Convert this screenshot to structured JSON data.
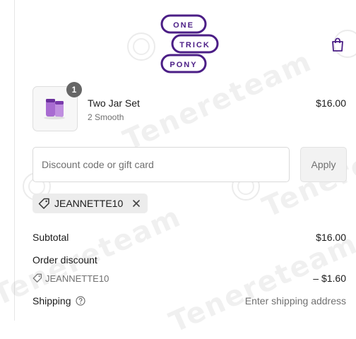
{
  "brand": {
    "logo_lines": [
      "ONE",
      "TRICK",
      "PONY"
    ],
    "color": "#4b1e86"
  },
  "cart": {
    "icon": "shopping-bag-icon"
  },
  "product": {
    "quantity": "1",
    "name": "Two Jar Set",
    "variant": "2 Smooth",
    "price": "$16.00"
  },
  "discount": {
    "placeholder": "Discount code or gift card",
    "apply_label": "Apply",
    "applied_code": "JEANNETTE10"
  },
  "summary": {
    "subtotal_label": "Subtotal",
    "subtotal_value": "$16.00",
    "order_discount_label": "Order discount",
    "discount_code": "JEANNETTE10",
    "discount_value": "– $1.60",
    "shipping_label": "Shipping",
    "shipping_value": "Enter shipping address"
  },
  "watermark": {
    "text": "Tenereteam"
  }
}
